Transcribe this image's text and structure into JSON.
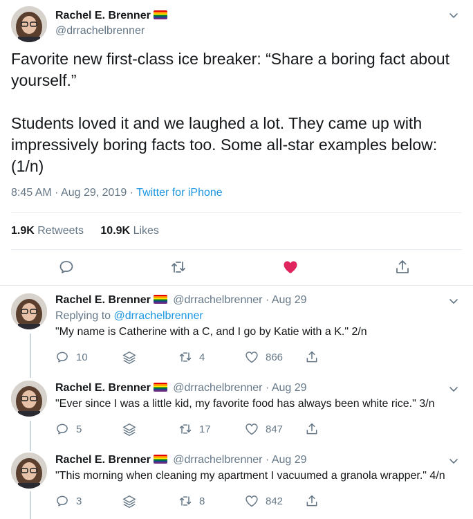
{
  "main_tweet": {
    "author_name": "Rachel E. Brenner",
    "handle": "@drrachelbrenner",
    "text": "Favorite new first-class ice breaker: “Share a boring fact about yourself.”\n\nStudents loved it and we laughed a lot. They came up with impressively boring facts too. Some all-star examples below: (1/n)",
    "time": "8:45 AM · Aug 29, 2019 · ",
    "source": "Twitter for iPhone",
    "retweets_count": "1.9K",
    "retweets_label": "Retweets",
    "likes_count": "10.9K",
    "likes_label": "Likes"
  },
  "replies": [
    {
      "author_name": "Rachel E. Brenner",
      "handle": "@drrachelbrenner",
      "date": "· Aug 29",
      "replying_label": "Replying to ",
      "replying_handle": "@drrachelbrenner",
      "text": "\"My name is Catherine with a C, and I  go by Katie with a K.\" 2/n",
      "reply_count": "10",
      "retweet_count": "4",
      "like_count": "866"
    },
    {
      "author_name": "Rachel E. Brenner",
      "handle": "@drrachelbrenner",
      "date": "· Aug 29",
      "text": "\"Ever since I was a little kid, my favorite food has always been white rice.\" 3/n",
      "reply_count": "5",
      "retweet_count": "17",
      "like_count": "847"
    },
    {
      "author_name": "Rachel E. Brenner",
      "handle": "@drrachelbrenner",
      "date": "· Aug 29",
      "text": "\"This morning when cleaning my apartment I vacuumed a granola wrapper.\" 4/n",
      "reply_count": "3",
      "retweet_count": "8",
      "like_count": "842"
    }
  ],
  "colors": {
    "text": "#14171a",
    "secondary": "#657786",
    "link": "#1b95e0",
    "like_active": "#e0245e",
    "divider": "#e6ecf0"
  },
  "icons": {
    "reply": "reply-icon",
    "retweet": "retweet-icon",
    "like": "heart-icon",
    "share": "share-icon",
    "stack": "stack-icon",
    "more": "chevron-down-icon",
    "flag": "rainbow-flag-icon"
  }
}
